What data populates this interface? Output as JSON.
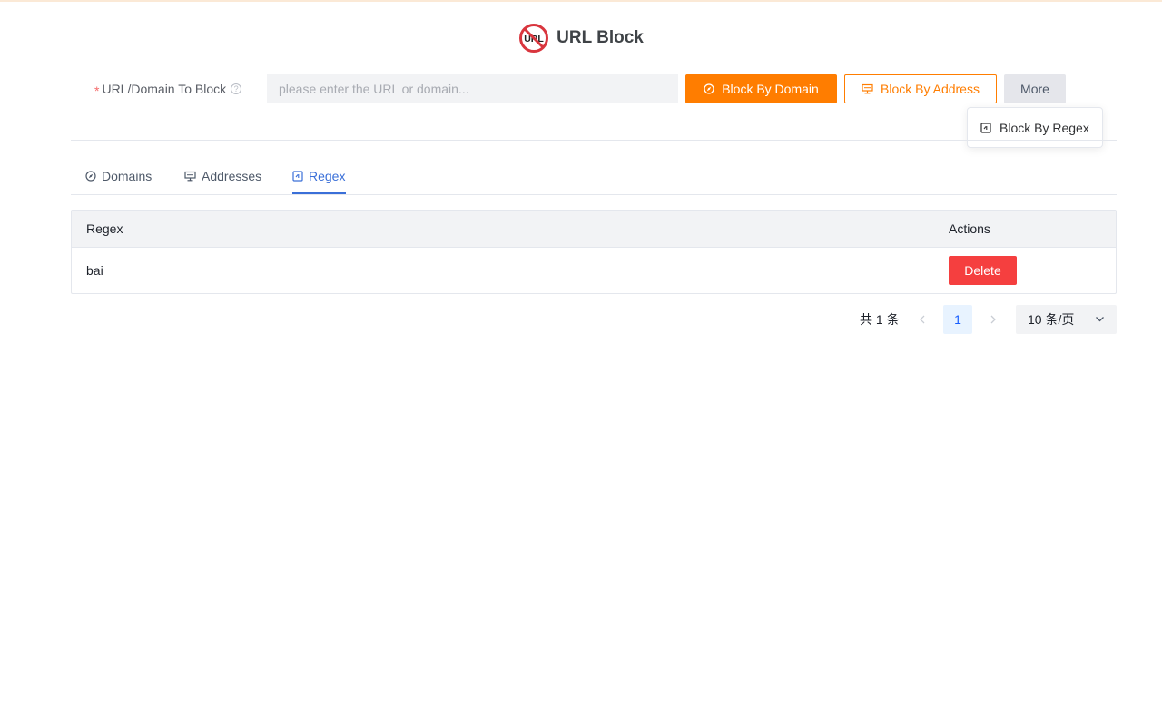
{
  "app": {
    "title": "URL Block",
    "logo_text": "URL",
    "colors": {
      "primary_orange": "#ff7d00",
      "danger_red": "#f53f3f",
      "tab_active_blue": "#3a6fd8",
      "logo_red": "#d9363e"
    }
  },
  "form": {
    "required_mark": "*",
    "label": "URL/Domain To Block",
    "help_icon": "question-circle-icon",
    "input_placeholder": "please enter the URL or domain...",
    "input_value": "",
    "block_domain_label": "Block By Domain",
    "block_domain_icon": "compass-icon",
    "block_address_label": "Block By Address",
    "block_address_icon": "monitor-icon",
    "more_label": "More"
  },
  "dropdown": {
    "items": [
      {
        "label": "Block By Regex",
        "icon": "regex-icon"
      }
    ]
  },
  "tabs": [
    {
      "label": "Domains",
      "icon": "compass-icon",
      "active": false
    },
    {
      "label": "Addresses",
      "icon": "monitor-icon",
      "active": false
    },
    {
      "label": "Regex",
      "icon": "regex-icon",
      "active": true
    }
  ],
  "table": {
    "columns": [
      "Regex",
      "Actions"
    ],
    "rows": [
      {
        "regex": "bai",
        "action_label": "Delete"
      }
    ]
  },
  "pagination": {
    "total_text": "共 1 条",
    "current_page": "1",
    "page_size_label": "10 条/页"
  }
}
